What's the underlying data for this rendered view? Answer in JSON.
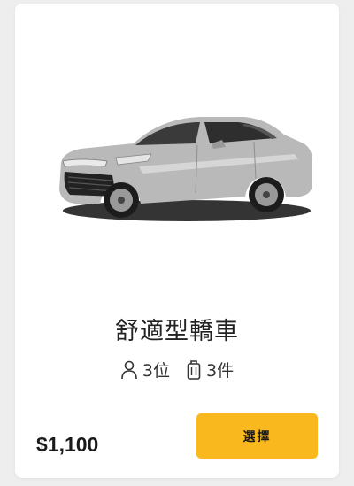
{
  "vehicle": {
    "image_alt": "car-image",
    "name": "舒適型轎車",
    "seats": "3位",
    "luggage": "3件",
    "price": "$1,100"
  },
  "actions": {
    "select_label": "選擇"
  },
  "colors": {
    "button": "#f9b81e",
    "card": "#ffffff",
    "background": "#eeeeee",
    "car_body": "#b5b5b5"
  },
  "icons": {
    "seats": "person-icon",
    "luggage": "luggage-icon"
  }
}
